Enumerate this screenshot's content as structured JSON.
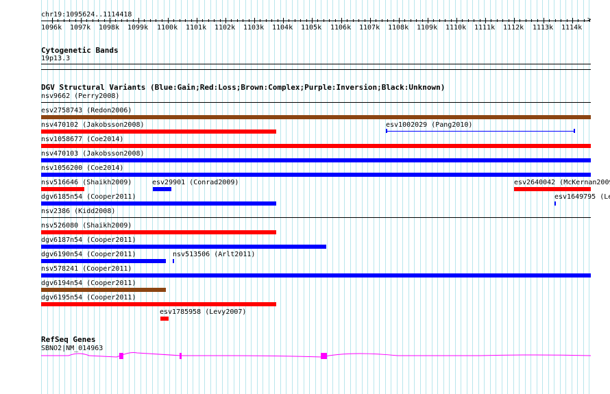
{
  "ruler": {
    "position": "chr19:1095624..1114418",
    "ticks": [
      "1096k",
      "1097k",
      "1098k",
      "1099k",
      "1100k",
      "1101k",
      "1102k",
      "1103k",
      "1104k",
      "1105k",
      "1106k",
      "1107k",
      "1108k",
      "1109k",
      "1110k",
      "1111k",
      "1112k",
      "1113k",
      "1114k"
    ]
  },
  "cytobands": {
    "title": "Cytogenetic Bands",
    "band": "19p13.3"
  },
  "dgv": {
    "title": "DGV Structural Variants (Blue:Gain;Red:Loss;Brown:Complex;Purple:Inversion;Black:Unknown)",
    "colors": {
      "gain": "#0000ff",
      "loss": "#ff0000",
      "complex": "#8b4513",
      "unknown": "#000000"
    },
    "variants": [
      {
        "label": "nsv9662 (Perry2008)",
        "type": "unknown"
      },
      {
        "label": "esv2758743 (Redon2006)",
        "type": "complex"
      },
      {
        "label": "nsv470102 (Jakobsson2008)",
        "type": "loss"
      },
      {
        "label": "esv1002029 (Pang2010)",
        "type": "gain"
      },
      {
        "label": "nsv1058677 (Coe2014)",
        "type": "loss"
      },
      {
        "label": "nsv470103 (Jakobsson2008)",
        "type": "gain"
      },
      {
        "label": "nsv1056200 (Coe2014)",
        "type": "gain"
      },
      {
        "label": "nsv516646 (Shaikh2009)",
        "type": "loss"
      },
      {
        "label": "esv29901 (Conrad2009)",
        "type": "gain"
      },
      {
        "label": "esv2640042 (McKernan2009)",
        "type": "loss"
      },
      {
        "label": "dgv6185n54 (Cooper2011)",
        "type": "gain"
      },
      {
        "label": "esv1649795 (Le",
        "type": "gain"
      },
      {
        "label": "nsv2386 (Kidd2008)",
        "type": "unknown"
      },
      {
        "label": "nsv526080 (Shaikh2009)",
        "type": "loss"
      },
      {
        "label": "dgv6187n54 (Cooper2011)",
        "type": "gain"
      },
      {
        "label": "dgv6190n54 (Cooper2011)",
        "type": "gain"
      },
      {
        "label": "nsv513506 (Arlt2011)",
        "type": "gain"
      },
      {
        "label": "nsv578241 (Cooper2011)",
        "type": "gain"
      },
      {
        "label": "dgv6194n54 (Cooper2011)",
        "type": "complex"
      },
      {
        "label": "dgv6195n54 (Cooper2011)",
        "type": "loss"
      },
      {
        "label": "esv1785958 (Levy2007)",
        "type": "loss"
      }
    ]
  },
  "refseq": {
    "title": "RefSeq Genes",
    "gene": "SBNO2|NM_014963",
    "color": "#ff00ff"
  }
}
